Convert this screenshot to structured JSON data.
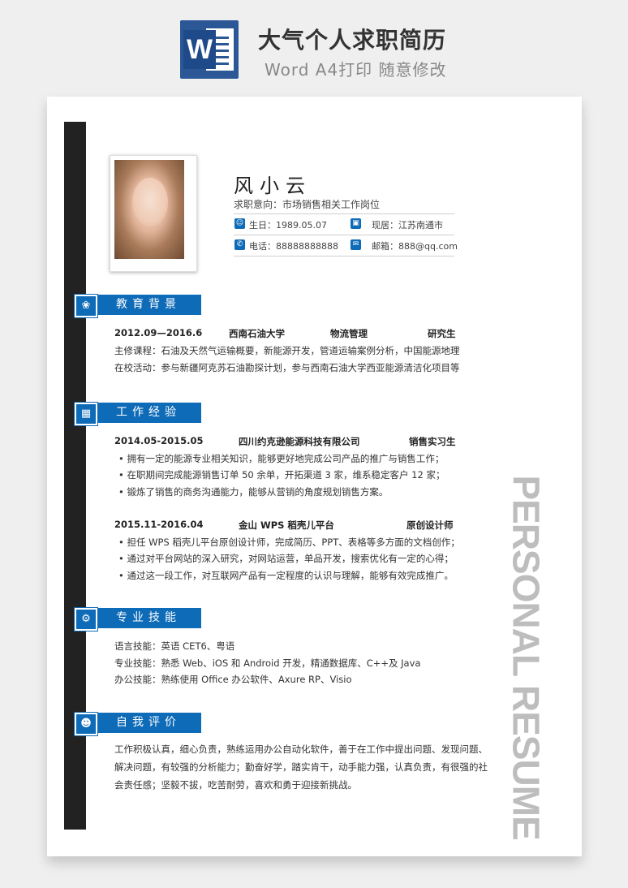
{
  "banner": {
    "title": "大气个人求职简历",
    "subtitle": "Word A4打印 随意修改",
    "icon": "word-icon",
    "icon_letter": "W"
  },
  "colors": {
    "accent": "#0e6bb8",
    "sidebar": "#222222",
    "watermark_text": "#bdbdbd"
  },
  "profile": {
    "name": "风小云",
    "intent": "求职意向：市场销售相关工作岗位",
    "birth": "生日：1989.05.07",
    "residence": "现居：江苏南通市",
    "phone": "电话：88888888888",
    "email": "邮箱：888@qq.com"
  },
  "education": {
    "title": "教育背景",
    "period": "2012.09—2016.6",
    "school": "西南石油大学",
    "major": "物流管理",
    "degree": "研究生",
    "lines": [
      "主修课程：石油及天然气运输概要，新能源开发，管道运输案例分析，中国能源地理",
      "在校活动：参与新疆阿克苏石油勘探计划，参与西南石油大学西亚能源清洁化项目等"
    ]
  },
  "work": {
    "title": "工作经验",
    "jobs": [
      {
        "period": "2014.05-2015.05",
        "company": "四川约克逊能源科技有限公司",
        "role": "销售实习生",
        "bullets": [
          "• 拥有一定的能源专业相关知识，能够更好地完成公司产品的推广与销售工作；",
          "• 在职期间完成能源销售订单 50 余单，开拓渠道 3 家，维系稳定客户 12 家；",
          "• 锻炼了销售的商务沟通能力，能够从营销的角度规划销售方案。"
        ]
      },
      {
        "period": "2015.11-2016.04",
        "company": "金山 WPS 稻壳儿平台",
        "role": "原创设计师",
        "bullets": [
          "• 担任 WPS 稻壳儿平台原创设计师，完成简历、PPT、表格等多方面的文档创作；",
          "• 通过对平台网站的深入研究，对网站运营，单品开发，搜索优化有一定的心得；",
          "• 通过这一段工作，对互联网产品有一定程度的认识与理解，能够有效完成推广。"
        ]
      }
    ]
  },
  "skills": {
    "title": "专业技能",
    "lines": [
      "语言技能：英语 CET6、粤语",
      "专业技能：熟悉 Web、iOS 和 Android 开发，精通数据库、C++及 Java",
      "办公技能：熟练使用 Office  办公软件、Axure RP、Visio"
    ]
  },
  "self_eval": {
    "title": "自我评价",
    "lines": [
      "工作积极认真，细心负责，熟练运用办公自动化软件，善于在工作中提出问题、发现问题、",
      "解决问题，有较强的分析能力；勤奋好学，踏实肯干，动手能力强，认真负责，有很强的社",
      "会责任感；坚毅不拔，吃苦耐劳，喜欢和勇于迎接新挑战。"
    ]
  },
  "vertical_label": "PERSONAL RESUME"
}
